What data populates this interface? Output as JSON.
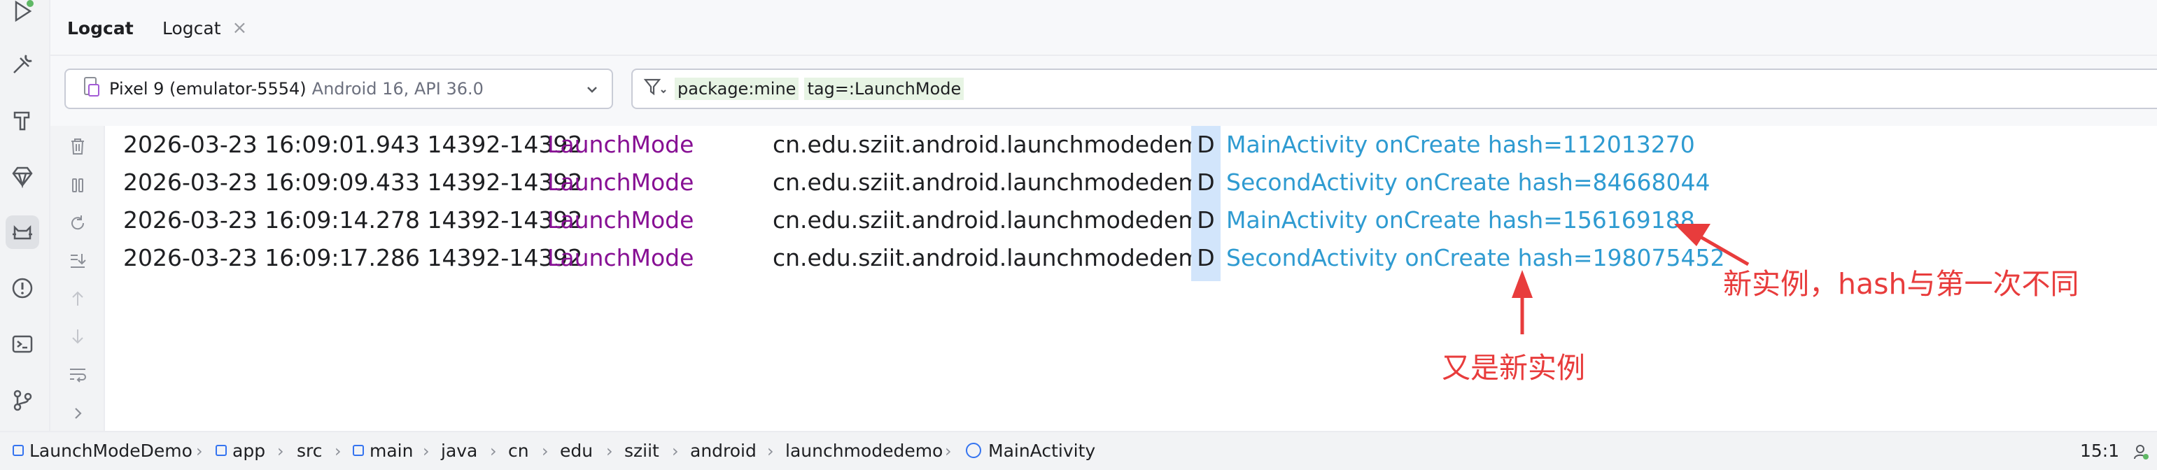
{
  "tabs": [
    {
      "label": "Logcat"
    },
    {
      "label": "Logcat",
      "close": "×"
    }
  ],
  "toolbar": {
    "device_name": "Pixel 9 (emulator-5554)",
    "device_sub": "Android 16, API 36.0",
    "filter_token_1": "package:mine",
    "filter_token_2": "tag=:LaunchMode"
  },
  "left_icons": [
    "run-icon",
    "build-tools-icon",
    "hammer-icon",
    "gem-icon",
    "logcat-icon",
    "problems-icon",
    "terminal-icon",
    "git-icon"
  ],
  "side_actions": [
    "trash-icon",
    "pause-icon",
    "restart-icon",
    "scroll-to-end-icon",
    "up-arrow-icon",
    "down-arrow-icon",
    "soft-wrap-icon",
    "expand-icon"
  ],
  "log_rows": [
    {
      "time": "2026-03-23 16:09:01.943 14392-14392",
      "tag": "LaunchMode",
      "pkg": "cn.edu.sziit.android.launchmodedemo",
      "level": "D",
      "msg": "MainActivity  onCreate  hash=112013270"
    },
    {
      "time": "2026-03-23 16:09:09.433 14392-14392",
      "tag": "LaunchMode",
      "pkg": "cn.edu.sziit.android.launchmodedemo",
      "level": "D",
      "msg": "SecondActivity onCreate  hash=84668044"
    },
    {
      "time": "2026-03-23 16:09:14.278 14392-14392",
      "tag": "LaunchMode",
      "pkg": "cn.edu.sziit.android.launchmodedemo",
      "level": "D",
      "msg": "MainActivity  onCreate  hash=156169188"
    },
    {
      "time": "2026-03-23 16:09:17.286 14392-14392",
      "tag": "LaunchMode",
      "pkg": "cn.edu.sziit.android.launchmodedemo",
      "level": "D",
      "msg": "SecondActivity onCreate  hash=198075452"
    }
  ],
  "annotations": {
    "new_instance_hash_differs": "新实例，hash与第一次不同",
    "new_instance_again": "又是新实例"
  },
  "breadcrumb": [
    "LaunchModeDemo",
    "app",
    "src",
    "main",
    "java",
    "cn",
    "edu",
    "sziit",
    "android",
    "launchmodedemo",
    "MainActivity"
  ],
  "status": {
    "cursor": "15:1"
  },
  "colors": {
    "tag": "#871094",
    "message": "#2f9bd1",
    "level_bg": "#d2e5fb",
    "annotation": "#e83c3c",
    "filter_token_bg": "#e7f4e4"
  }
}
